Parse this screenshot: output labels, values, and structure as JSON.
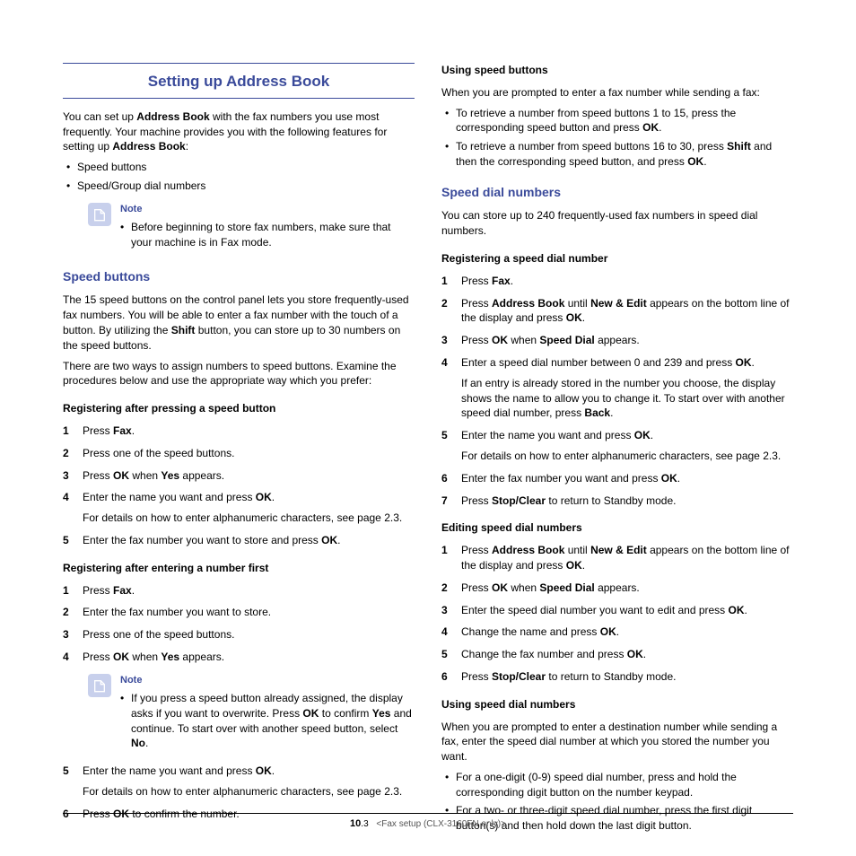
{
  "title": "Setting up Address Book",
  "intro": {
    "p1_a": "You can set up ",
    "p1_b": "Address Book",
    "p1_c": " with the fax numbers you use most frequently. Your machine provides you with the following features for setting up ",
    "p1_d": "Address Book",
    "p1_e": ":",
    "bullets": [
      "Speed buttons",
      "Speed/Group dial numbers"
    ]
  },
  "note1": {
    "label": "Note",
    "text": "Before beginning to store fax numbers, make sure that your machine is in Fax mode."
  },
  "speed_buttons": {
    "heading": "Speed buttons",
    "p1_a": "The 15 speed buttons on the control panel lets you store frequently-used fax numbers. You will be able to enter a fax number with the touch of a button. By utilizing the ",
    "p1_b": "Shift",
    "p1_c": " button, you can store up to 30 numbers on the speed buttons.",
    "p2": "There are two ways to assign numbers to speed buttons. Examine the procedures below and use the appropriate way which you prefer:",
    "sub1": "Registering after pressing a speed button",
    "steps1": {
      "s1_a": "Press ",
      "s1_b": "Fax",
      "s1_c": ".",
      "s2": "Press one of the speed buttons.",
      "s3_a": "Press ",
      "s3_b": "OK",
      "s3_c": " when ",
      "s3_d": "Yes",
      "s3_e": " appears.",
      "s4_a": "Enter the name you want and press ",
      "s4_b": "OK",
      "s4_c": ".",
      "s4_sub": "For details on how to enter alphanumeric characters, see page 2.3.",
      "s5_a": "Enter the fax number you want to store and press ",
      "s5_b": "OK",
      "s5_c": "."
    },
    "sub2": "Registering after entering a number first",
    "steps2": {
      "s1_a": "Press ",
      "s1_b": "Fax",
      "s1_c": ".",
      "s2": "Enter the fax number you want to store.",
      "s3": "Press one of the speed buttons.",
      "s4_a": "Press ",
      "s4_b": "OK",
      "s4_c": " when ",
      "s4_d": "Yes",
      "s4_e": " appears.",
      "s5_a": "Enter the name you want and press ",
      "s5_b": "OK",
      "s5_c": ".",
      "s5_sub": "For details on how to enter alphanumeric characters, see page 2.3.",
      "s6_a": "Press ",
      "s6_b": "OK",
      "s6_c": " to confirm the number."
    }
  },
  "note2": {
    "label": "Note",
    "t1": "If you press a speed button already assigned, the display asks if you want to overwrite. Press ",
    "t2": "OK",
    "t3": " to confirm ",
    "t4": "Yes",
    "t5": " and continue. To start over with another speed button, select ",
    "t6": "No",
    "t7": "."
  },
  "using_speed_buttons": {
    "heading": "Using speed buttons",
    "p1": "When you are prompted to enter a fax number while sending a fax:",
    "b1_a": "To retrieve a number from speed buttons 1 to 15, press the corresponding speed button and press ",
    "b1_b": "OK",
    "b1_c": ".",
    "b2_a": "To retrieve a number from speed buttons 16 to 30, press ",
    "b2_b": "Shift",
    "b2_c": " and then the corresponding speed button, and press ",
    "b2_d": "OK",
    "b2_e": "."
  },
  "speed_dial": {
    "heading": "Speed dial numbers",
    "p1": "You can store up to 240 frequently-used fax numbers in speed dial numbers.",
    "sub1": "Registering a speed dial number",
    "reg": {
      "s1_a": "Press ",
      "s1_b": "Fax",
      "s1_c": ".",
      "s2_a": "Press ",
      "s2_b": "Address Book",
      "s2_c": " until ",
      "s2_d": "New & Edit",
      "s2_e": " appears on the bottom line of the display and press ",
      "s2_f": "OK",
      "s2_g": ".",
      "s3_a": "Press ",
      "s3_b": "OK",
      "s3_c": " when ",
      "s3_d": "Speed Dial",
      "s3_e": " appears.",
      "s4_a": "Enter a speed dial number between 0 and 239 and press ",
      "s4_b": "OK",
      "s4_c": ".",
      "s4_sub_a": "If an entry is already stored in the number you choose, the display shows the name to allow you to change it. To start over with another speed dial number, press ",
      "s4_sub_b": "Back",
      "s4_sub_c": ".",
      "s5_a": "Enter the name you want and press ",
      "s5_b": "OK",
      "s5_c": ".",
      "s5_sub": "For details on how to enter alphanumeric characters, see page 2.3.",
      "s6_a": "Enter the fax number you want and press ",
      "s6_b": "OK",
      "s6_c": ".",
      "s7_a": "Press ",
      "s7_b": "Stop/Clear",
      "s7_c": " to return to Standby mode."
    },
    "sub2": "Editing speed dial numbers",
    "edit": {
      "s1_a": "Press ",
      "s1_b": "Address Book",
      "s1_c": " until ",
      "s1_d": "New & Edit",
      "s1_e": " appears on the bottom line of the display and press ",
      "s1_f": "OK",
      "s1_g": ".",
      "s2_a": "Press ",
      "s2_b": "OK",
      "s2_c": " when ",
      "s2_d": "Speed Dial",
      "s2_e": " appears.",
      "s3_a": "Enter the speed dial number you want to edit and press ",
      "s3_b": "OK",
      "s3_c": ".",
      "s4_a": "Change the name and press ",
      "s4_b": "OK",
      "s4_c": ".",
      "s5_a": "Change the fax number and press ",
      "s5_b": "OK",
      "s5_c": ".",
      "s6_a": "Press ",
      "s6_b": "Stop/Clear",
      "s6_c": " to return to Standby mode."
    },
    "sub3": "Using speed dial numbers",
    "use_p1": "When you are prompted to enter a destination number while sending a fax, enter the speed dial number at which you stored the number you want.",
    "use_b1": "For a one-digit (0-9) speed dial number, press and hold the corresponding digit button on the number keypad.",
    "use_b2": "For a two- or three-digit speed dial number, press the first digit button(s) and then hold down the last digit button."
  },
  "footer": {
    "page_bold": "10",
    "page_rest": ".3",
    "chapter": "<Fax setup (CLX-3160FN only)>"
  }
}
